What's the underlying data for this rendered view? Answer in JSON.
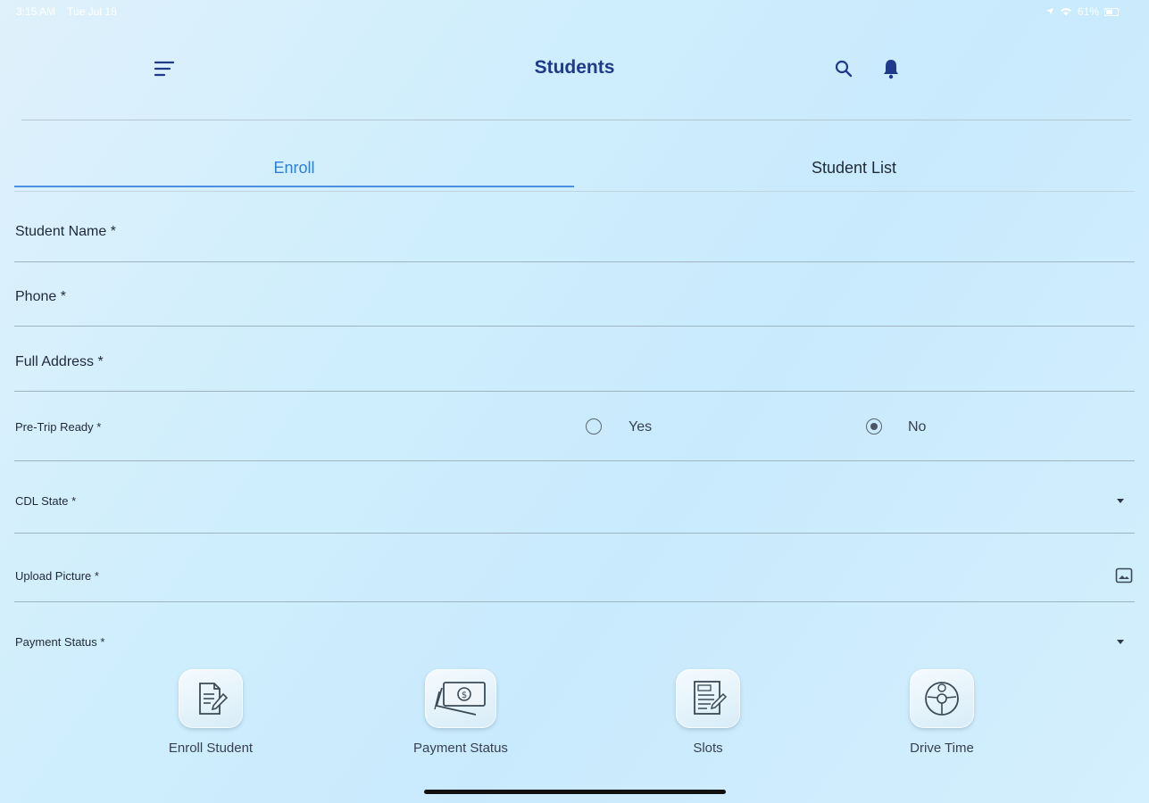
{
  "status_bar": {
    "time": "3:15 AM",
    "date": "Tue Jul 18",
    "battery": "61%"
  },
  "header": {
    "title": "Students"
  },
  "tabs": [
    {
      "label": "Enroll",
      "active": true
    },
    {
      "label": "Student List",
      "active": false
    }
  ],
  "form": {
    "student_name_label": "Student Name *",
    "phone_label": "Phone *",
    "address_label": "Full Address *",
    "pretrip": {
      "label": "Pre-Trip Ready *",
      "options": [
        "Yes",
        "No"
      ],
      "selected": "No"
    },
    "cdl_state_label": "CDL State *",
    "upload_picture_label": "Upload Picture *",
    "payment_status_label": "Payment Status *"
  },
  "bottom_nav": [
    {
      "label": "Enroll Student",
      "icon": "document-edit-icon"
    },
    {
      "label": "Payment Status",
      "icon": "money-icon"
    },
    {
      "label": "Slots",
      "icon": "test-sheet-icon"
    },
    {
      "label": "Drive Time",
      "icon": "steering-driver-icon"
    }
  ],
  "colors": {
    "title": "#1f3a8a",
    "active_tab": "#2f7fd6",
    "background": "#cfeefd"
  }
}
